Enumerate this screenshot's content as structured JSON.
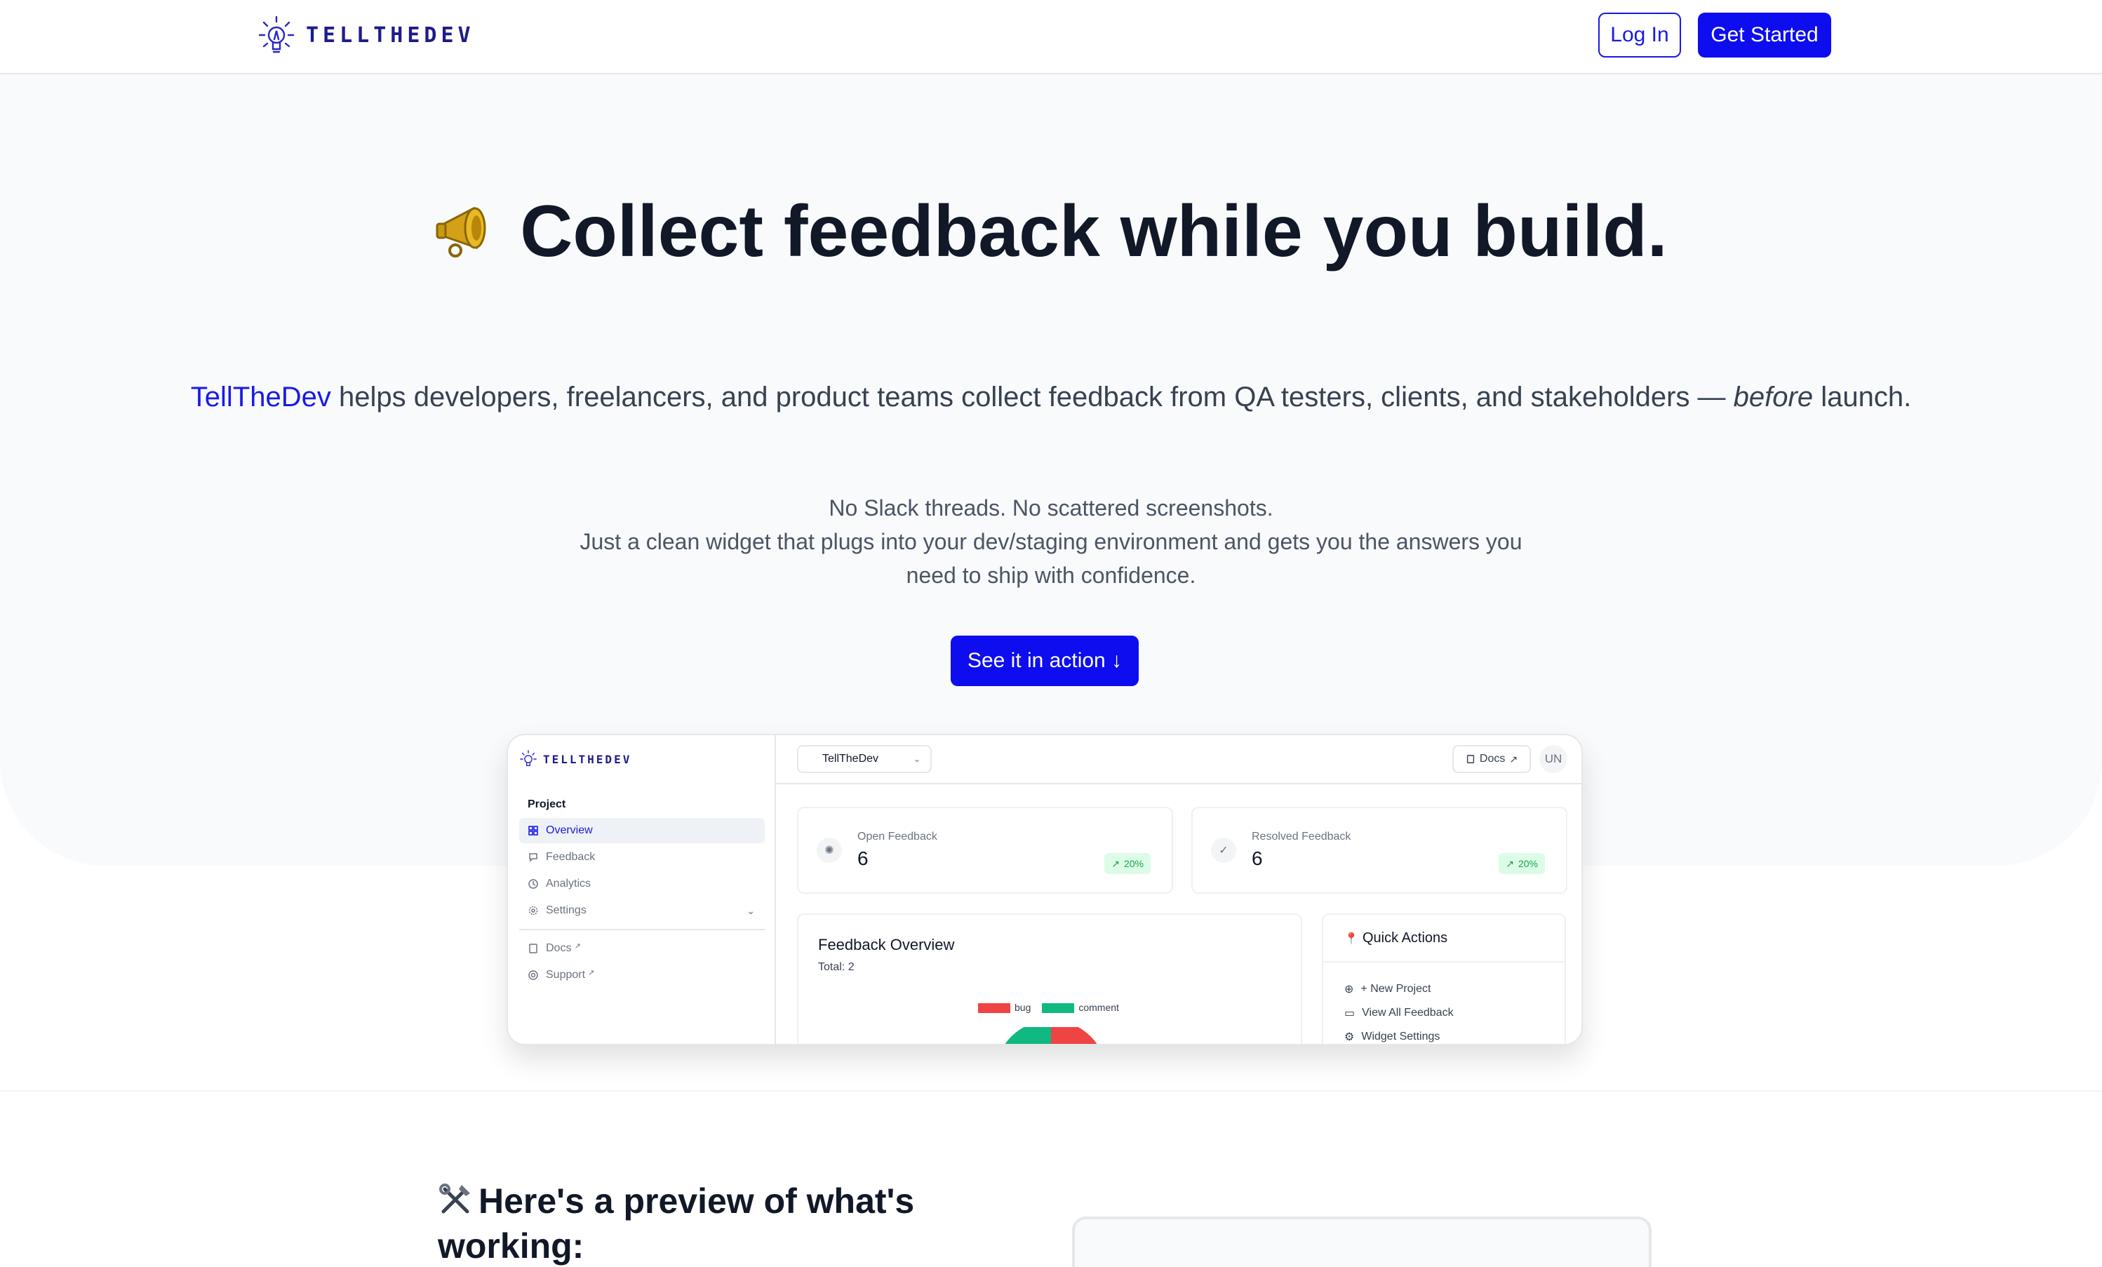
{
  "header": {
    "brand": "TELLTHEDEV",
    "login_label": "Log In",
    "get_started_label": "Get Started"
  },
  "hero": {
    "title": "Collect feedback while you build.",
    "subtitle_brand": "TellTheDev",
    "subtitle_part1": " helps developers, freelancers, and product teams collect feedback from QA testers, clients, and stakeholders — ",
    "subtitle_em": "before",
    "subtitle_part2": " launch.",
    "desc_line1": "No Slack threads. No scattered screenshots.",
    "desc_line2": "Just a clean widget that plugs into your dev/staging environment and gets you the answers you need to ship with confidence.",
    "cta_label": "See it in action ↓"
  },
  "dashboard": {
    "brand": "TELLTHEDEV",
    "section_label": "Project",
    "nav": [
      {
        "label": "Overview",
        "icon": "grid-icon"
      },
      {
        "label": "Feedback",
        "icon": "message-icon"
      },
      {
        "label": "Analytics",
        "icon": "clock-icon"
      },
      {
        "label": "Settings",
        "icon": "gear-icon"
      },
      {
        "label": "Docs",
        "icon": "book-icon"
      },
      {
        "label": "Support",
        "icon": "lifebuoy-icon"
      }
    ],
    "project_select": "TellTheDev",
    "docs_label": "Docs",
    "avatar": "UN",
    "stats": [
      {
        "label": "Open Feedback",
        "value": "6",
        "trend": "20%"
      },
      {
        "label": "Resolved Feedback",
        "value": "6",
        "trend": "20%"
      }
    ],
    "overview": {
      "title": "Feedback Overview",
      "total": "Total: 2",
      "legend": [
        {
          "label": "bug",
          "color": "#ef4444"
        },
        {
          "label": "comment",
          "color": "#10b981"
        }
      ]
    },
    "quick_actions": {
      "title": "Quick Actions",
      "items": [
        "+ New Project",
        "View All Feedback",
        "Widget Settings"
      ]
    }
  },
  "preview": {
    "title": "Here's a preview of what's working:"
  },
  "colors": {
    "accent": "#0d0df0",
    "brand_text": "#1a1ae6",
    "success": "#16a34a"
  }
}
